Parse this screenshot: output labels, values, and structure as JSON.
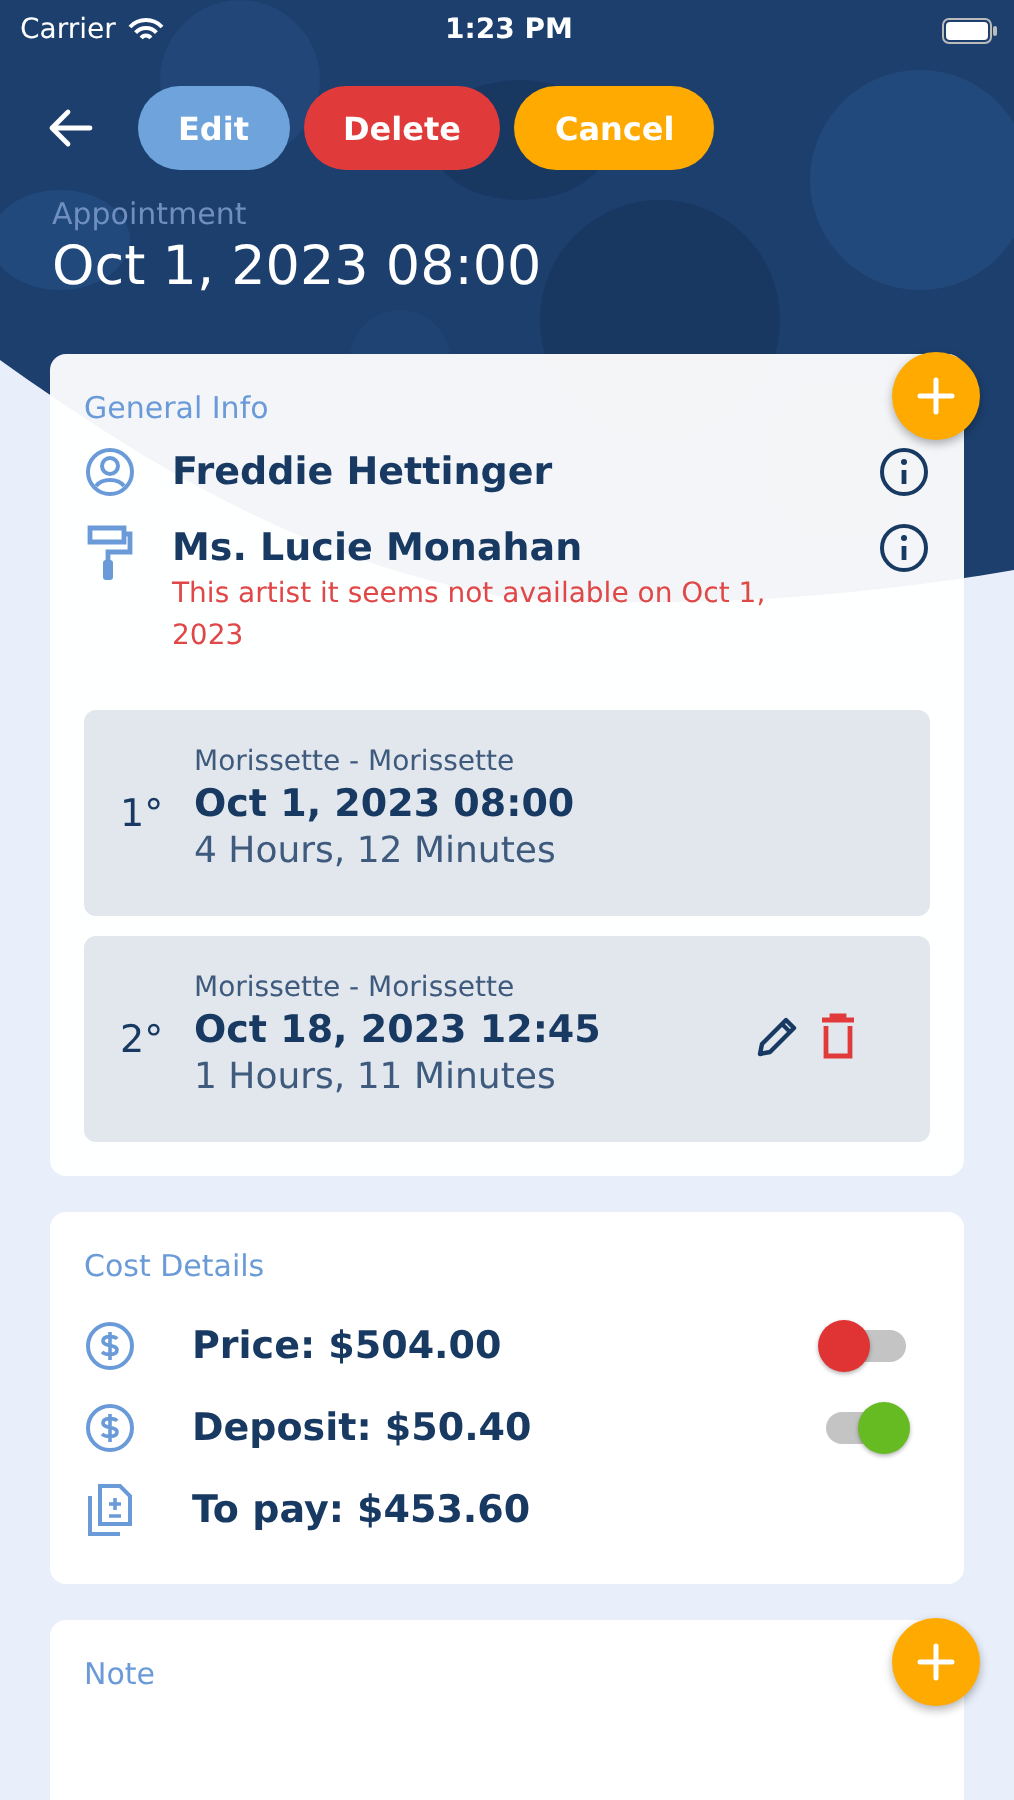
{
  "status_bar": {
    "carrier": "Carrier",
    "time": "1:23 PM"
  },
  "toolbar": {
    "buttons": [
      {
        "label": "Edit",
        "kind": "edit"
      },
      {
        "label": "Delete",
        "kind": "delete"
      },
      {
        "label": "Cancel",
        "kind": "cancel"
      }
    ]
  },
  "header": {
    "subtitle": "Appointment",
    "title": "Oct 1, 2023 08:00"
  },
  "general_info": {
    "title": "General Info",
    "people": [
      {
        "kind": "client",
        "name": "Freddie Hettinger"
      },
      {
        "kind": "artist",
        "name": "Ms. Lucie Monahan",
        "warning": "This artist it seems not available on Oct 1, 2023"
      }
    ],
    "sessions": [
      {
        "index": "1°",
        "location": "Morissette - Morissette",
        "date": "Oct 1, 2023 08:00",
        "duration": "4 Hours, 12 Minutes",
        "editable": false
      },
      {
        "index": "2°",
        "location": "Morissette - Morissette",
        "date": "Oct 18, 2023 12:45",
        "duration": "1 Hours, 11 Minutes",
        "editable": true
      }
    ]
  },
  "cost_details": {
    "title": "Cost Details",
    "rows": [
      {
        "kind": "price",
        "label": "Price: $504.00",
        "on": false
      },
      {
        "kind": "deposit",
        "label": "Deposit: $50.40",
        "on": true
      },
      {
        "kind": "total",
        "label": "To pay: $453.60"
      }
    ]
  },
  "note": {
    "title": "Note"
  }
}
